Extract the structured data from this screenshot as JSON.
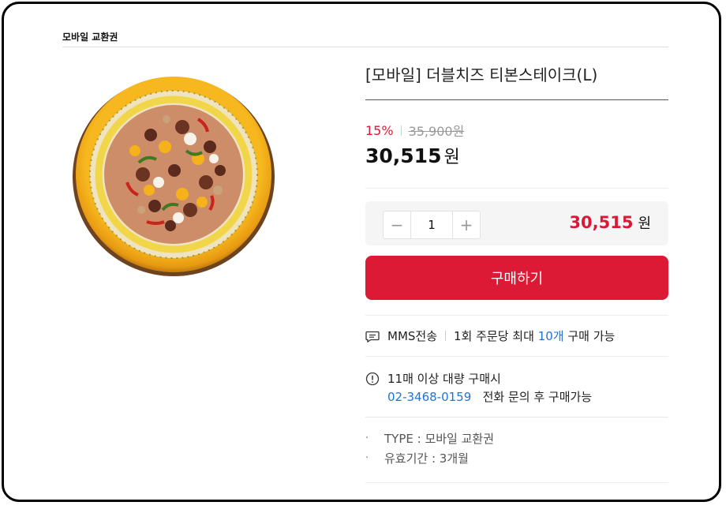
{
  "breadcrumb": "모바일 교환권",
  "product": {
    "title": "[모바일] 더블치즈 티본스테이크(L)",
    "discount": "15%",
    "original_price": "35,900원",
    "sale_price": "30,515",
    "currency": "원"
  },
  "quantity": {
    "minus_label": "−",
    "plus_label": "+",
    "value": "1",
    "total": "30,515",
    "total_unit": "원"
  },
  "buy_label": "구매하기",
  "delivery": {
    "method": "MMS전송",
    "limit_prefix": "1회 주문당 최대",
    "limit_count": "10개",
    "limit_suffix": "구매 가능"
  },
  "bulk": {
    "line1": "11매 이상 대량 구매시",
    "phone": "02-3468-0159",
    "line2_suffix": "전화 문의 후 구매가능"
  },
  "specs": [
    {
      "bullet": "·",
      "text": "TYPE : 모바일 교환권"
    },
    {
      "bullet": "·",
      "text": "유효기간 : 3개월"
    }
  ],
  "colors": {
    "accent": "#dc1a35",
    "link": "#1f73d8"
  },
  "icons": {
    "message": "message-icon",
    "info": "info-circle-icon"
  }
}
